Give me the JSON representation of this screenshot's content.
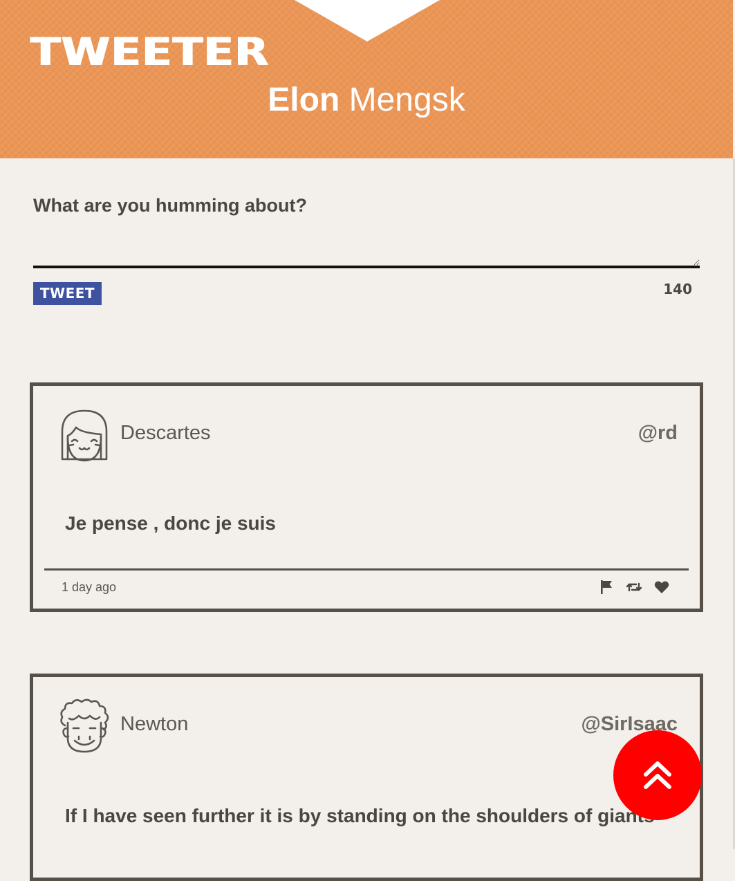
{
  "header": {
    "brand": "TWEETER",
    "user_first": "Elon",
    "user_last": "Mengsk",
    "background_color": "#ec9656"
  },
  "compose": {
    "label": "What are you humming about?",
    "value": "",
    "placeholder": "",
    "submit_label": "TWEET",
    "submit_color": "#3f52a0",
    "char_count": "140"
  },
  "tweets": [
    {
      "name": "Descartes",
      "handle": "@rd",
      "avatar_icon": "girl-face-avatar-icon",
      "text": "Je pense , donc je suis",
      "timestamp": "1 day ago",
      "actions": [
        "flag-icon",
        "retweet-icon",
        "heart-icon"
      ]
    },
    {
      "name": "Newton",
      "handle": "@SirIsaac",
      "avatar_icon": "curly-hair-face-avatar-icon",
      "text": "If I have seen further it is by standing on the shoulders of giants"
    }
  ],
  "scroll_top": {
    "icon": "double-chevron-up-icon",
    "color": "#ff0000"
  }
}
